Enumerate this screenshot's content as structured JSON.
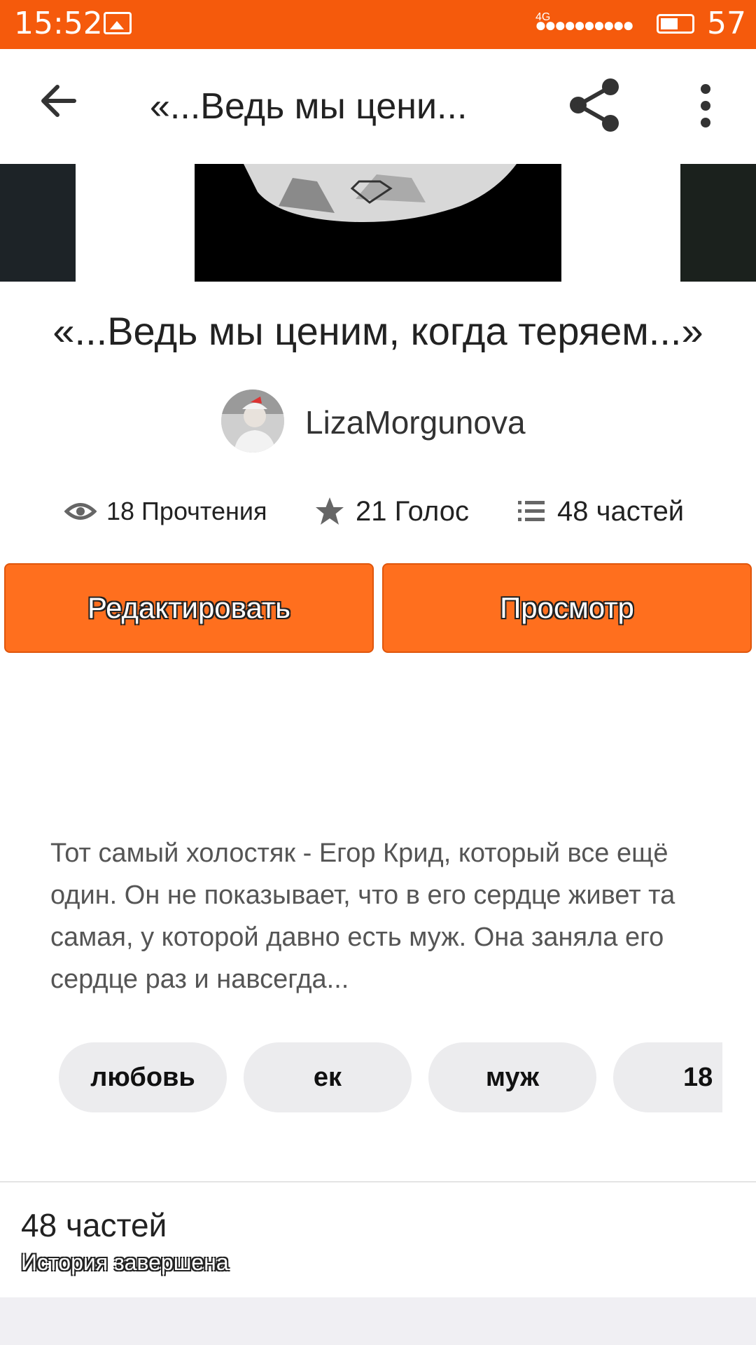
{
  "status_bar": {
    "time": "15:52",
    "network": "4G",
    "signal_dots": "●●●●●●●●●●",
    "battery_level": 0.57,
    "battery_percent": "57",
    "photo_icon": "gallery-notification-icon"
  },
  "toolbar": {
    "title": "«...Ведь мы цени...",
    "back_icon": "arrow-left-icon",
    "share_icon": "share-icon",
    "more_icon": "more-vert-icon"
  },
  "story": {
    "title": "«...Ведь мы ценим, когда теряем...»",
    "author": "LizaMorgunova",
    "stats": {
      "reads": "18 Прочтения",
      "votes": "21 Голос",
      "parts": "48 частей"
    },
    "edit_label": "Редактировать",
    "preview_label": "Просмотр",
    "description": "Тот самый холостяк - Егор Крид, который все ещё один. Он не показывает, что в его сердце живет та самая, у которой давно есть муж. Она заняла его сердце раз и навсегда...",
    "tags": [
      "любовь",
      "ек",
      "муж",
      "18"
    ],
    "parts_count": "48 частей",
    "parts_status": "История завершена"
  },
  "colors": {
    "accent": "#f55a0c",
    "button": "#ff6f1e",
    "tag_bg": "#ececee"
  }
}
